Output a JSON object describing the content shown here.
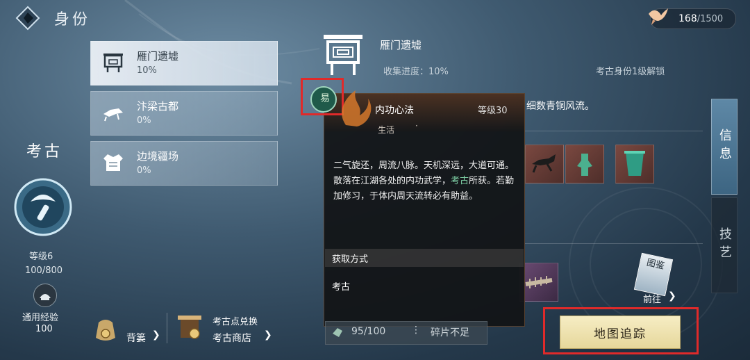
{
  "header": {
    "title": "身份",
    "currency_value": "168",
    "currency_max": "/1500"
  },
  "left_rail": {
    "title": "考古",
    "level": "等级6",
    "progress": "100/800",
    "xp_label": "通用经验",
    "xp_value": "100"
  },
  "sites": [
    {
      "name": "雁门遗墟",
      "pct": "10%"
    },
    {
      "name": "汴梁古都",
      "pct": "0%"
    },
    {
      "name": "边境疆场",
      "pct": "0%"
    }
  ],
  "detail": {
    "name": "雁门遗墟",
    "progress": "收集进度：10%",
    "unlock": "考古身份1级解锁",
    "desc": "细数青铜风流。"
  },
  "tabs": {
    "info": "信息",
    "skill": "技艺"
  },
  "popup": {
    "seal": "易",
    "name": "内功心法",
    "level": "等级30",
    "category": "生活",
    "dot": "·",
    "body_1": "二气旋还，周流八脉。天机深远，大道可通。",
    "body_2a": "散落在江湖各处的内功武学，",
    "body_2hl": "考古",
    "body_2b": "所获。若勤加修习，于体内周天流转必有助益。",
    "get_head": "获取方式",
    "source": "考古"
  },
  "fragments": {
    "value": "95/100",
    "sep": "⋮",
    "status": "碎片不足"
  },
  "bottom": {
    "bag": "背篓",
    "shop_top": "考古点兑换",
    "shop": "考古商店"
  },
  "goto": {
    "card": "图鉴",
    "label": "前往"
  },
  "track_button": "地图追踪",
  "colors": {
    "highlight": "#7fd1a6",
    "annotation_red": "#e02a2a",
    "button_gold": "#e6d79b"
  }
}
